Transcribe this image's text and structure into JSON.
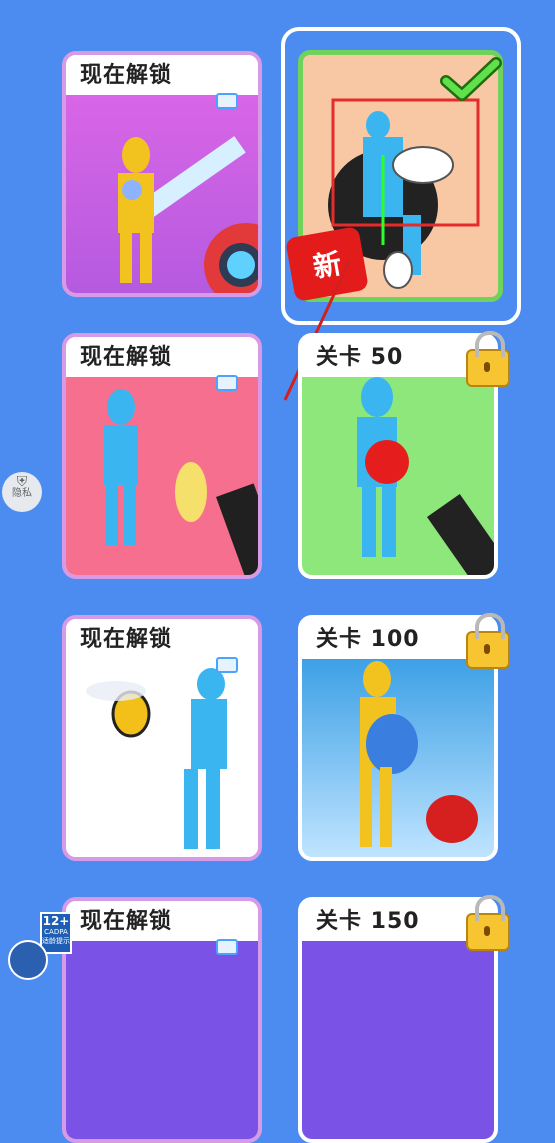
{
  "cards": [
    {
      "id": "c1",
      "label": "现在解锁"
    },
    {
      "id": "c2",
      "label": ""
    },
    {
      "id": "c3",
      "label": "现在解锁"
    },
    {
      "id": "c4",
      "label": "关卡 50"
    },
    {
      "id": "c5",
      "label": "现在解锁"
    },
    {
      "id": "c6",
      "label": "关卡 100"
    },
    {
      "id": "c7",
      "label": "现在解锁"
    },
    {
      "id": "c8",
      "label": "关卡 150"
    }
  ],
  "new_badge": "新",
  "privacy_label": "隐私",
  "age_rating": {
    "top": "12+",
    "mid": "CADPA",
    "bottom": "适龄提示"
  },
  "colors": {
    "bg": "#4c8cf0",
    "unlock_border": "#d79ae6",
    "selected_border": "#6ed25b"
  }
}
